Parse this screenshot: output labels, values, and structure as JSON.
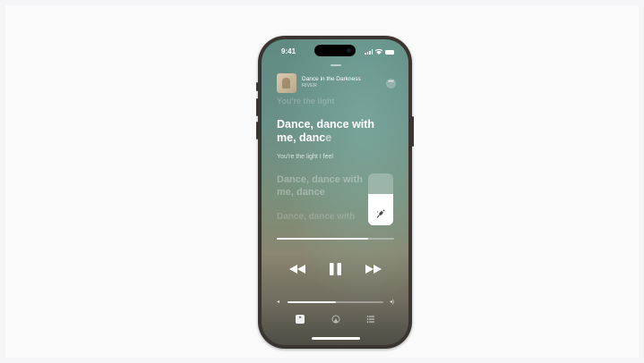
{
  "status_bar": {
    "time": "9:41"
  },
  "now_playing": {
    "song_title": "Dance in the Darkness",
    "artist": "RIVER",
    "more_icon": "ellipsis-icon"
  },
  "lyrics": {
    "previous_line": "You're the light",
    "current_line_1": "Dance, dance with",
    "current_line_2_sung": "me, danc",
    "current_line_2_unsung": "e",
    "background_vocal": "You're the light I feel",
    "next_line_1": "Dance, dance with",
    "next_line_2": "me, dance",
    "following_line": "Dance, dance with"
  },
  "vocal_control": {
    "level": 0.6,
    "icon": "mic-sparkle-icon"
  },
  "playback": {
    "progress": 0.78
  },
  "volume": {
    "level": 0.5
  },
  "tabs": [
    "lyrics-icon",
    "airplay-icon",
    "queue-icon"
  ]
}
